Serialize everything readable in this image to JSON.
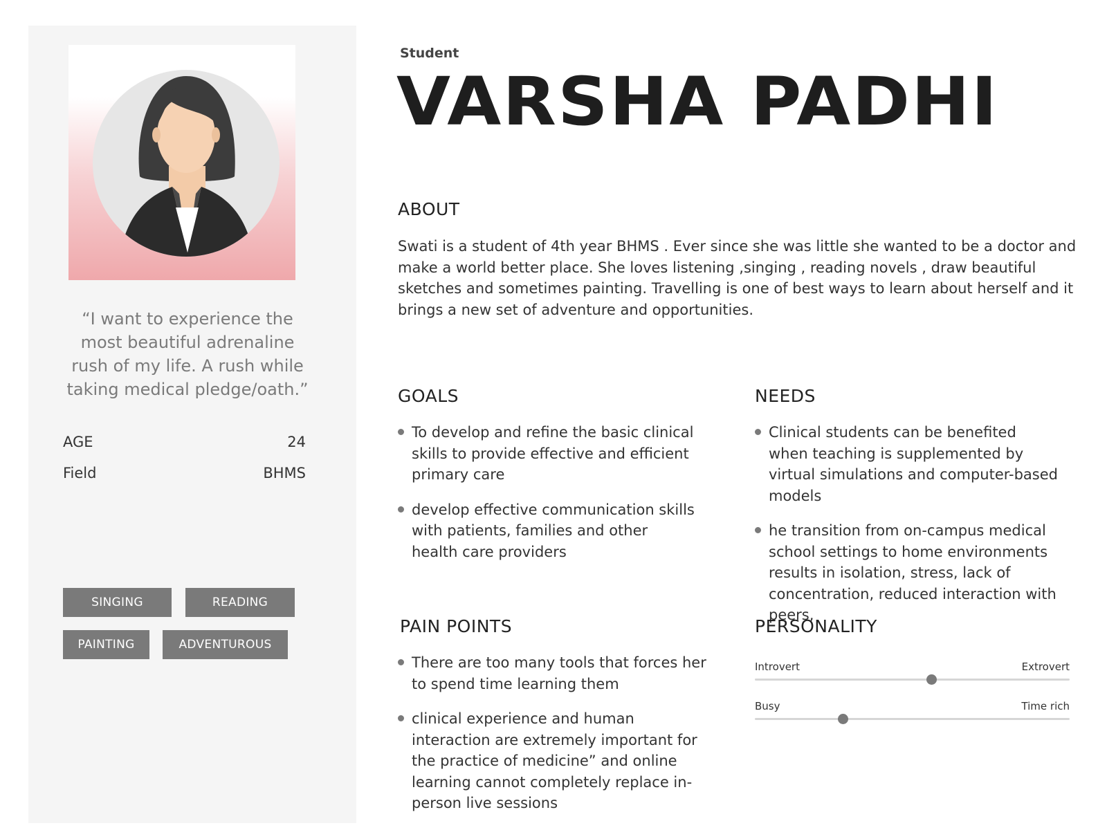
{
  "profile": {
    "role": "Student",
    "name": "VARSHA PADHI",
    "quote": "“I want to experience the most beautiful adrenaline rush of my life. A rush while taking medical pledge/oath.”",
    "age_label": "AGE",
    "age_value": "24",
    "field_label": "Field",
    "field_value": "BHMS",
    "avatar_icon": "female-avatar-icon"
  },
  "tags": [
    "SINGING",
    "READING",
    "PAINTING",
    "ADVENTUROUS"
  ],
  "about": {
    "title": "ABOUT",
    "text": "Swati is a student of 4th year BHMS . Ever since she was little she wanted to be a doctor and make a world better place. She loves listening ,singing , reading novels , draw beautiful sketches and sometimes painting. Travelling is one of best ways to learn about herself and it brings a new set of adventure and opportunities."
  },
  "goals": {
    "title": "GOALS",
    "items": [
      "To develop and refine the basic clinical skills to provide effective and efficient primary care",
      "develop effective communication skills with patients, families and other health care providers"
    ]
  },
  "needs": {
    "title": "NEEDS",
    "items": [
      " Clinical students can be benefited when teaching is supplemented by virtual simulations and computer-based models",
      "he transition from on-campus medical school settings to home environments results in isolation, stress, lack of concentration, reduced interaction with peers,"
    ]
  },
  "pain_points": {
    "title": "PAIN POINTS",
    "items": [
      "There are too many tools that forces her to spend time learning them",
      "clinical experience and human interaction are extremely important for the practice of medicine” and online learning cannot completely replace in-person live sessions"
    ]
  },
  "personality": {
    "title": "PERSONALITY",
    "sliders": [
      {
        "left": "Introvert",
        "right": "Extrovert",
        "value": 0.56
      },
      {
        "left": "Busy",
        "right": "Time rich",
        "value": 0.28
      }
    ]
  },
  "colors": {
    "tag_bg": "#7a7a7a",
    "sidebar_bg": "#f5f5f5",
    "photo_gradient_end": "#efa8ab"
  }
}
